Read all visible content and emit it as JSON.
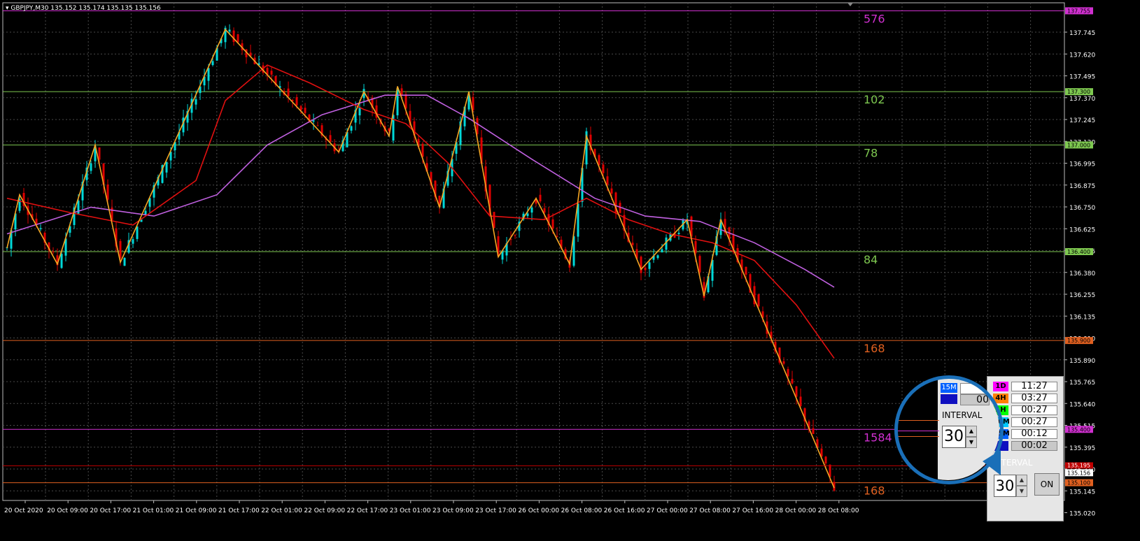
{
  "symbol_header": "GBPJPY,M30  135.152 135.174 135.135 135.156",
  "colors": {
    "background": "#000000",
    "grid": "#4a4a4a",
    "axis_text": "#ffffff",
    "candle_up": "#00d8d8",
    "candle_down": "#e00000",
    "ma_fast": "#e01010",
    "ma_slow": "#c060e0",
    "zigzag": "#f5a623",
    "level_green": "#7ec850",
    "level_orange": "#e06020",
    "level_magenta": "#d030d0"
  },
  "price_axis": {
    "ticks": [
      "137.745",
      "137.620",
      "137.495",
      "137.370",
      "137.245",
      "137.120",
      "136.995",
      "136.875",
      "136.750",
      "136.625",
      "136.505",
      "136.380",
      "136.255",
      "136.135",
      "136.010",
      "135.890",
      "135.765",
      "135.640",
      "135.515",
      "135.395",
      "135.270",
      "135.145",
      "135.020"
    ]
  },
  "time_axis": {
    "labels": [
      "20 Oct 2020",
      "20 Oct 09:00",
      "20 Oct 17:00",
      "21 Oct 01:00",
      "21 Oct 09:00",
      "21 Oct 17:00",
      "22 Oct 01:00",
      "22 Oct 09:00",
      "22 Oct 17:00",
      "23 Oct 01:00",
      "23 Oct 09:00",
      "23 Oct 17:00",
      "26 Oct 00:00",
      "26 Oct 08:00",
      "26 Oct 16:00",
      "27 Oct 00:00",
      "27 Oct 08:00",
      "27 Oct 16:00",
      "28 Oct 00:00",
      "28 Oct 08:00"
    ]
  },
  "levels": [
    {
      "price": 137.755,
      "label": "137.755",
      "count": "576",
      "color": "#d030d0"
    },
    {
      "price": 137.3,
      "label": "137.300",
      "count": "102",
      "color": "#7ec850"
    },
    {
      "price": 137.0,
      "label": "137.000",
      "count": "78",
      "color": "#7ec850"
    },
    {
      "price": 136.4,
      "label": "136.400",
      "count": "84",
      "color": "#7ec850"
    },
    {
      "price": 135.9,
      "label": "135.900",
      "count": "168",
      "color": "#e06020"
    },
    {
      "price": 135.4,
      "label": "135.400",
      "count": "1584",
      "color": "#d030d0"
    },
    {
      "price": 135.1,
      "label": "135.100",
      "count": "168",
      "color": "#e06020"
    }
  ],
  "current_price": {
    "label": "135.156",
    "price": 135.156
  },
  "red_price": {
    "label": "135.195",
    "price": 135.195
  },
  "chart_data": {
    "type": "candlestick",
    "symbol": "GBPJPY",
    "timeframe": "M30",
    "ylim": [
      135.0,
      137.8
    ],
    "zigzag": [
      [
        0,
        136.42
      ],
      [
        3,
        136.72
      ],
      [
        12,
        136.33
      ],
      [
        21,
        137.0
      ],
      [
        27,
        136.34
      ],
      [
        52,
        137.65
      ],
      [
        79,
        136.96
      ],
      [
        85,
        137.3
      ],
      [
        91,
        137.05
      ],
      [
        93,
        137.33
      ],
      [
        103,
        136.65
      ],
      [
        110,
        137.3
      ],
      [
        117,
        136.37
      ],
      [
        126,
        136.7
      ],
      [
        134,
        136.33
      ],
      [
        138,
        137.05
      ],
      [
        151,
        136.3
      ],
      [
        162,
        136.58
      ],
      [
        166,
        136.15
      ],
      [
        170,
        136.58
      ],
      [
        197,
        135.07
      ]
    ],
    "ma_fast": [
      [
        0,
        136.7
      ],
      [
        15,
        136.62
      ],
      [
        30,
        136.55
      ],
      [
        45,
        136.8
      ],
      [
        52,
        137.25
      ],
      [
        62,
        137.45
      ],
      [
        72,
        137.35
      ],
      [
        85,
        137.2
      ],
      [
        95,
        137.12
      ],
      [
        105,
        136.9
      ],
      [
        115,
        136.6
      ],
      [
        128,
        136.58
      ],
      [
        138,
        136.7
      ],
      [
        148,
        136.58
      ],
      [
        158,
        136.5
      ],
      [
        168,
        136.45
      ],
      [
        178,
        136.35
      ],
      [
        188,
        136.1
      ],
      [
        197,
        135.8
      ]
    ],
    "ma_slow": [
      [
        0,
        136.5
      ],
      [
        20,
        136.65
      ],
      [
        35,
        136.6
      ],
      [
        50,
        136.72
      ],
      [
        62,
        137.0
      ],
      [
        75,
        137.17
      ],
      [
        90,
        137.28
      ],
      [
        100,
        137.28
      ],
      [
        110,
        137.15
      ],
      [
        125,
        136.92
      ],
      [
        140,
        136.7
      ],
      [
        152,
        136.6
      ],
      [
        165,
        136.57
      ],
      [
        178,
        136.45
      ],
      [
        190,
        136.3
      ],
      [
        197,
        136.2
      ]
    ]
  },
  "timer_panel": {
    "rows": [
      {
        "tf": "1D",
        "time": "11:27",
        "color": "#ff00ff",
        "gray": false
      },
      {
        "tf": "4H",
        "time": "03:27",
        "color": "#ff7f00",
        "gray": false
      },
      {
        "tf": "1H",
        "time": "00:27",
        "color": "#00ff00",
        "gray": false
      },
      {
        "tf": "30M",
        "time": "00:27",
        "color": "#00c8ff",
        "gray": false
      },
      {
        "tf": "15M",
        "time": "00:12",
        "color": "#0060ff",
        "gray": false
      },
      {
        "tf": "5M",
        "time": "00:02",
        "color": "#1010c0",
        "gray": true
      }
    ],
    "interval_label": "INTERVAL",
    "interval_value": "30",
    "on_label": "ON"
  },
  "magnifier": {
    "rows": [
      {
        "tf": "15M",
        "time": "00",
        "color": "#0060ff"
      },
      {
        "tf": "5M",
        "time": "00",
        "color": "#1010c0"
      }
    ],
    "interval_label": "INTERVAL",
    "interval_value": "30"
  }
}
